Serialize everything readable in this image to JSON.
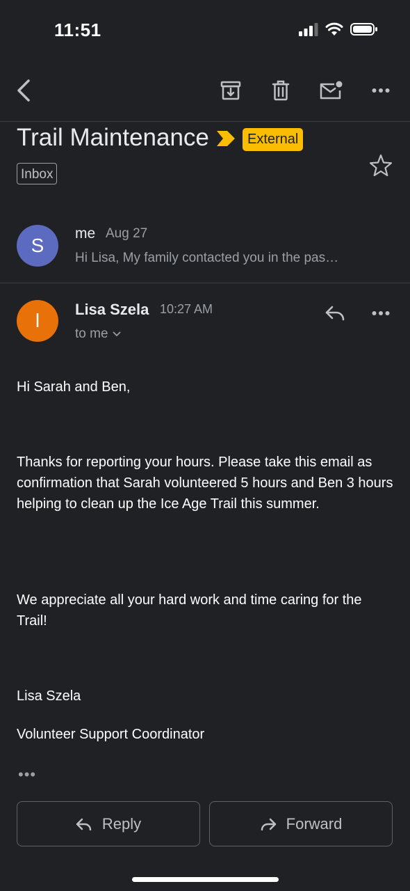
{
  "status_bar": {
    "time": "11:51",
    "icons": [
      "cellular-signal-icon",
      "wifi-icon",
      "battery-icon"
    ]
  },
  "toolbar": {
    "icons": [
      "back-arrow-icon",
      "archive-icon",
      "trash-icon",
      "mark-unread-icon",
      "more-vert-icon"
    ]
  },
  "email": {
    "subject": "Trail Maintenance",
    "external_badge": "External",
    "label": "Inbox"
  },
  "thread": {
    "collapsed_message": {
      "avatar_letter": "S",
      "avatar_color": "#5c6bc0",
      "sender": "me",
      "date": "Aug 27",
      "snippet": "Hi Lisa, My family contacted you in the past about hours worked on the trail"
    },
    "message": {
      "avatar_letter": "l",
      "avatar_color": "#e8710a",
      "sender": "Lisa Szela",
      "time": "10:27 AM",
      "recipient": "to me",
      "body": {
        "greeting": "Hi Sarah and Ben,",
        "paragraph1": "Thanks for reporting your hours. Please take this email as confirmation that Sarah volunteered 5 hours and Ben 3 hours helping to clean up the Ice Age Trail this summer.",
        "paragraph2": "We appreciate all your hard work and time caring for the Trail!",
        "signature_name": "Lisa Szela",
        "signature_title": "Volunteer Support Coordinator",
        "trimmed_content": "•••"
      }
    }
  },
  "actions": {
    "reply": "Reply",
    "forward": "Forward"
  },
  "colors": {
    "background": "#202124",
    "badge": "#fbbc04",
    "importance": "#fbbc04"
  }
}
